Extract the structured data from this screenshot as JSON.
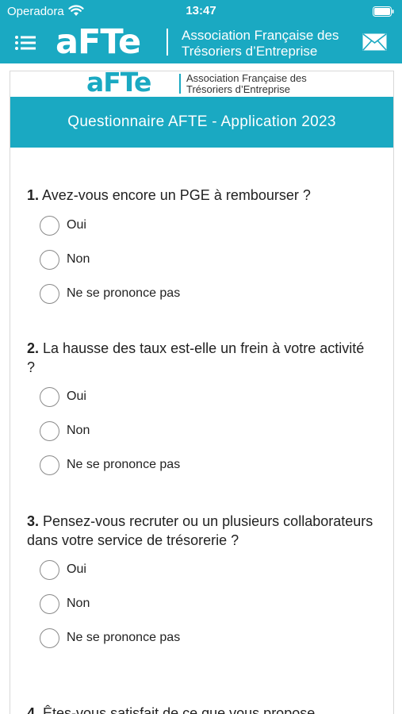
{
  "status_bar": {
    "carrier": "Operadora",
    "time": "13:47"
  },
  "header": {
    "logo_text": "aFTe",
    "tagline_line1": "Association Française des",
    "tagline_line2": "Trésoriers d’Entreprise"
  },
  "card": {
    "logo_text": "aFTe",
    "tagline_line1": "Association Française des",
    "tagline_line2": "Trésoriers d’Entreprise",
    "banner_title": "Questionnaire AFTE - Application 2023"
  },
  "questions": [
    {
      "number": "1.",
      "text": "Avez-vous encore un PGE à rembourser ?",
      "options": [
        "Oui",
        "Non",
        "Ne se prononce pas"
      ]
    },
    {
      "number": "2.",
      "text": "La hausse des taux est-elle un frein à votre activité ?",
      "options": [
        "Oui",
        "Non",
        "Ne se prononce pas"
      ]
    },
    {
      "number": "3.",
      "text": "Pensez-vous recruter ou un plusieurs collaborateurs dans votre service de trésorerie ?",
      "options": [
        "Oui",
        "Non",
        "Ne se prononce pas"
      ]
    },
    {
      "number": "4.",
      "text": "Êtes-vous satisfait de ce que vous propose"
    }
  ],
  "colors": {
    "brand": "#1aa9c2",
    "radio_border": "#8a8a8a"
  },
  "icons": {
    "menu": "hamburger-icon",
    "mail": "envelope-icon",
    "wifi": "wifi-icon",
    "battery": "battery-icon"
  }
}
